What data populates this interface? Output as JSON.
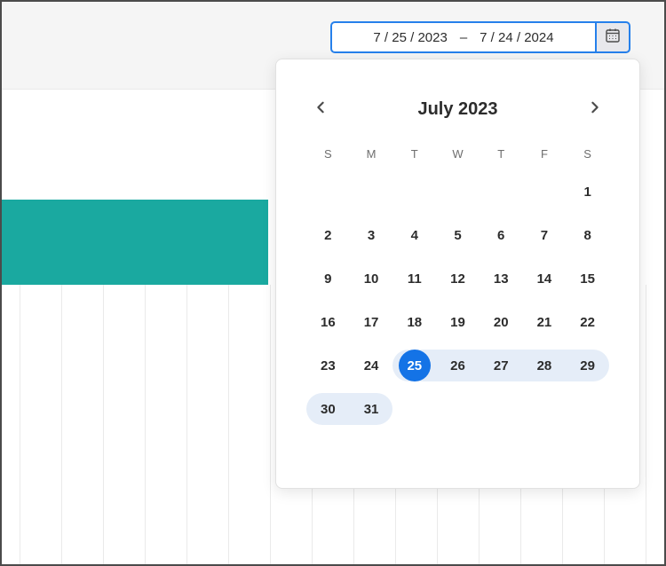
{
  "dateRange": {
    "start": "7 / 25 / 2023",
    "separator": "–",
    "end": "7 / 24 / 2024"
  },
  "calendar": {
    "title": "July 2023",
    "dow": [
      "S",
      "M",
      "T",
      "W",
      "T",
      "F",
      "S"
    ],
    "leadingBlanks": 6,
    "daysInMonth": 31,
    "selectedStart": 25,
    "rangeEnd": 31
  },
  "gridlines": {
    "start": 20,
    "spacing": 47,
    "count": 16
  }
}
